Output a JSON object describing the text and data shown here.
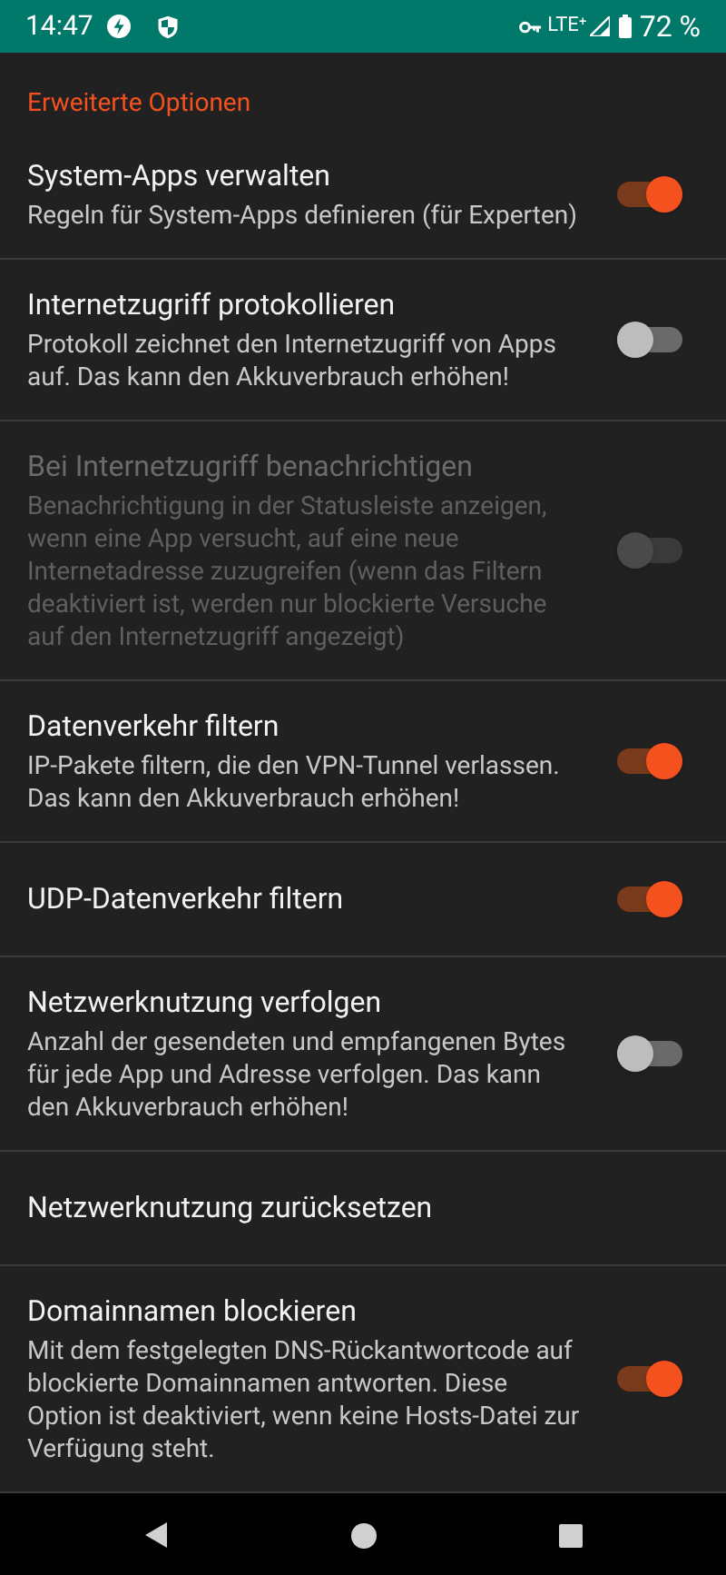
{
  "status_bar": {
    "time": "14:47",
    "network": "LTE⁺",
    "battery": "72 %"
  },
  "section": {
    "title": "Erweiterte Optionen"
  },
  "settings": [
    {
      "title": "System-Apps verwalten",
      "summary": "Regeln für System-Apps definieren (für Experten)",
      "kind": "switch",
      "on": true,
      "disabled": false
    },
    {
      "title": "Internetzugriff protokollieren",
      "summary": "Protokoll zeichnet den Internetzugriff von Apps auf. Das kann den Akkuverbrauch erhöhen!",
      "kind": "switch",
      "on": false,
      "disabled": false
    },
    {
      "title": "Bei Internetzugriff benachrichtigen",
      "summary": "Benachrichtigung in der Statusleiste anzeigen, wenn eine App versucht, auf eine neue Internetadresse zuzugreifen (wenn das Filtern deaktiviert ist, werden nur blockierte Versuche auf den Internetzugriff angezeigt)",
      "kind": "switch",
      "on": false,
      "disabled": true
    },
    {
      "title": "Datenverkehr filtern",
      "summary": "IP-Pakete filtern, die den VPN-Tunnel verlassen. Das kann den Akkuverbrauch erhöhen!",
      "kind": "switch",
      "on": true,
      "disabled": false
    },
    {
      "title": "UDP-Datenverkehr filtern",
      "kind": "switch",
      "on": true,
      "disabled": false
    },
    {
      "title": "Netzwerknutzung verfolgen",
      "summary": "Anzahl der gesendeten und empfangenen Bytes für jede App und Adresse verfolgen. Das kann den Akkuverbrauch erhöhen!",
      "kind": "switch",
      "on": false,
      "disabled": false
    },
    {
      "title": "Netzwerknutzung zurücksetzen",
      "kind": "action",
      "disabled": false
    },
    {
      "title": "Domainnamen blockieren",
      "summary": "Mit dem festgelegten DNS-Rückantwortcode auf blockierte Domainnamen antworten. Diese Option ist deaktiviert, wenn keine Hosts-Datei zur Verfügung steht.",
      "kind": "switch",
      "on": true,
      "disabled": false
    }
  ]
}
